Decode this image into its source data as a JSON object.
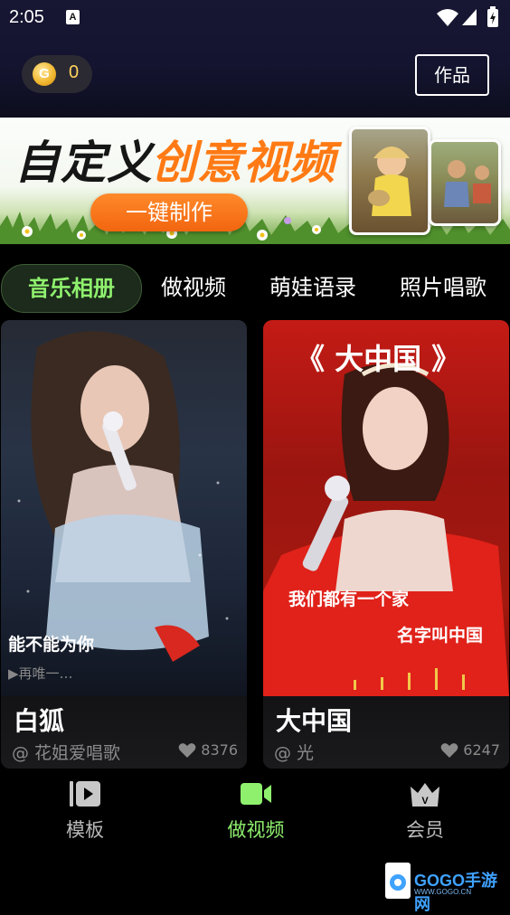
{
  "status_bar": {
    "time": "2:05",
    "a_badge": "A"
  },
  "header": {
    "coin_icon_letter": "G",
    "coin_count": "0",
    "works_button": "作品"
  },
  "banner": {
    "title_part1": "自定义",
    "title_part2": "创意视频",
    "cta": "一键制作"
  },
  "tabs": [
    "音乐相册",
    "做视频",
    "萌娃语录",
    "照片唱歌"
  ],
  "cards": [
    {
      "title": "白狐",
      "author": "@ 花姐爱唱歌",
      "likes": "8376",
      "overlay_text": "能不能为你",
      "overlay_sub": "▶再唯一…"
    },
    {
      "title": "大中国",
      "author": "@ 光",
      "likes": "6247",
      "overlay_title": "《 大中国 》",
      "overlay_text": "我们都有一个家",
      "overlay_sub": "名字叫中国"
    }
  ],
  "bottom_nav": {
    "items": [
      {
        "label": "模板",
        "icon": "play-film-icon"
      },
      {
        "label": "做视频",
        "icon": "video-camera-icon"
      },
      {
        "label": "会员",
        "icon": "vip-crown-icon"
      }
    ],
    "active_index": 1
  },
  "watermark": {
    "text": "GOGO手游网",
    "sub": "WWW.GOGO.CN"
  },
  "colors": {
    "accent_green": "#8ff06e",
    "banner_orange": "#ff7a14",
    "coin_gold": "#ffd35c",
    "header_bg": "#171733"
  }
}
